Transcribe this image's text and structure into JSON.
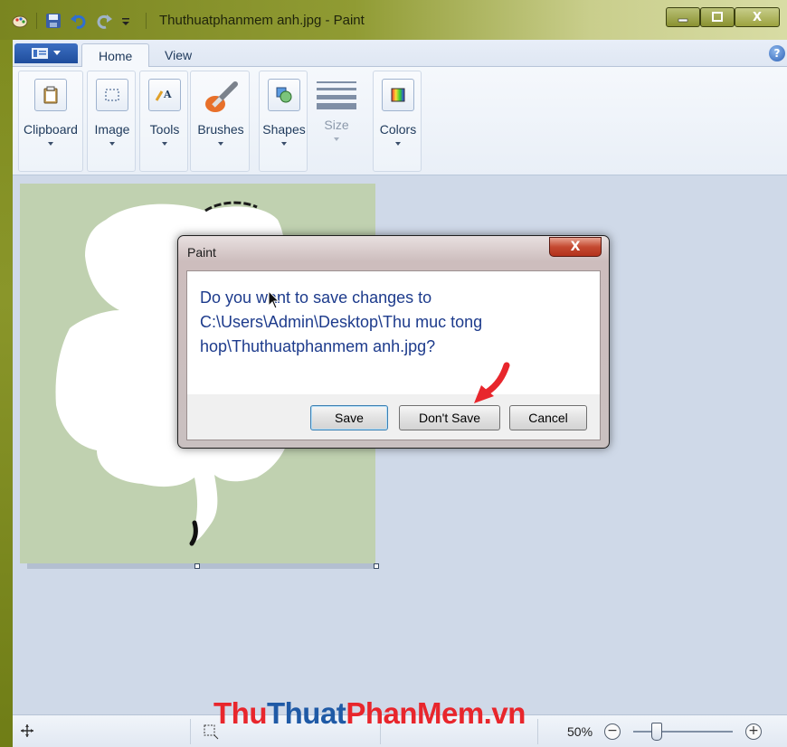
{
  "window": {
    "title": "Thuthuatphanmem anh.jpg - Paint",
    "caption_close": "X"
  },
  "ribbon": {
    "tabs": [
      {
        "label": "Home",
        "active": true
      },
      {
        "label": "View",
        "active": false
      }
    ],
    "help": "?",
    "groups": [
      {
        "label": "Clipboard",
        "icon": "clipboard-icon",
        "enabled": true
      },
      {
        "label": "Image",
        "icon": "select-icon",
        "enabled": true
      },
      {
        "label": "Tools",
        "icon": "tools-icon",
        "enabled": true
      },
      {
        "label": "Brushes",
        "icon": "brush-icon",
        "enabled": true
      },
      {
        "label": "Shapes",
        "icon": "shapes-icon",
        "enabled": true
      },
      {
        "label": "Size",
        "icon": "size-icon",
        "enabled": false
      },
      {
        "label": "Colors",
        "icon": "colors-icon",
        "enabled": true
      }
    ]
  },
  "dialog": {
    "title": "Paint",
    "close": "X",
    "message": "Do you want to save changes to C:\\Users\\Admin\\Desktop\\Thu muc tong hop\\Thuthuatphanmem anh.jpg?",
    "buttons": {
      "save": "Save",
      "dont_save": "Don't Save",
      "cancel": "Cancel"
    }
  },
  "status": {
    "zoom": "50%",
    "zoom_out": "−",
    "zoom_in": "+",
    "zoom_level": 0.5
  },
  "watermark": {
    "part1": "Thu",
    "part2": "Thuat",
    "part3": "PhanMem.vn"
  },
  "colors": {
    "canvas_bg": "#c0d1b0",
    "workspace": "#cfd9e8",
    "dialog_text": "#1d3b8c",
    "arrow": "#e8262c"
  }
}
